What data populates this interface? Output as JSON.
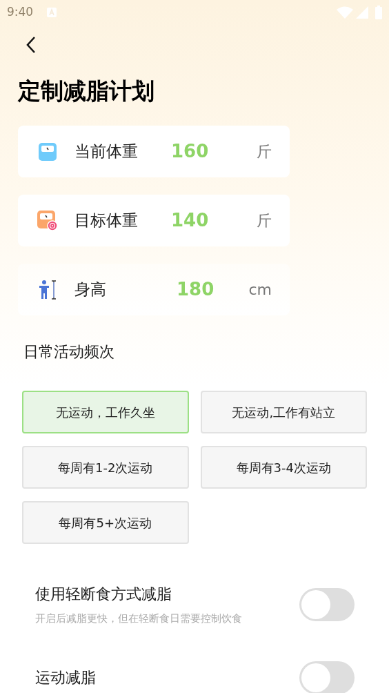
{
  "status_bar": {
    "time": "9:40"
  },
  "title": "定制减脂计划",
  "fields": [
    {
      "kind": "current",
      "label": "当前体重",
      "value": "160",
      "unit": "斤"
    },
    {
      "kind": "target",
      "label": "目标体重",
      "value": "140",
      "unit": "斤"
    },
    {
      "kind": "height",
      "label": "身高",
      "value": "180",
      "unit": "cm"
    }
  ],
  "activity": {
    "label": "日常活动频次",
    "options": [
      {
        "label": "无运动，工作久坐",
        "selected": true
      },
      {
        "label": "无运动,工作有站立",
        "selected": false
      },
      {
        "label": "每周有1-2次运动",
        "selected": false
      },
      {
        "label": "每周有3-4次运动",
        "selected": false
      },
      {
        "label": "每周有5+次运动",
        "selected": false
      }
    ]
  },
  "toggles": [
    {
      "label": "使用轻断食方式减脂",
      "description": "开启后减脂更快，但在轻断食日需要控制饮食",
      "on": false
    },
    {
      "label": "运动减脂",
      "on": false
    }
  ]
}
